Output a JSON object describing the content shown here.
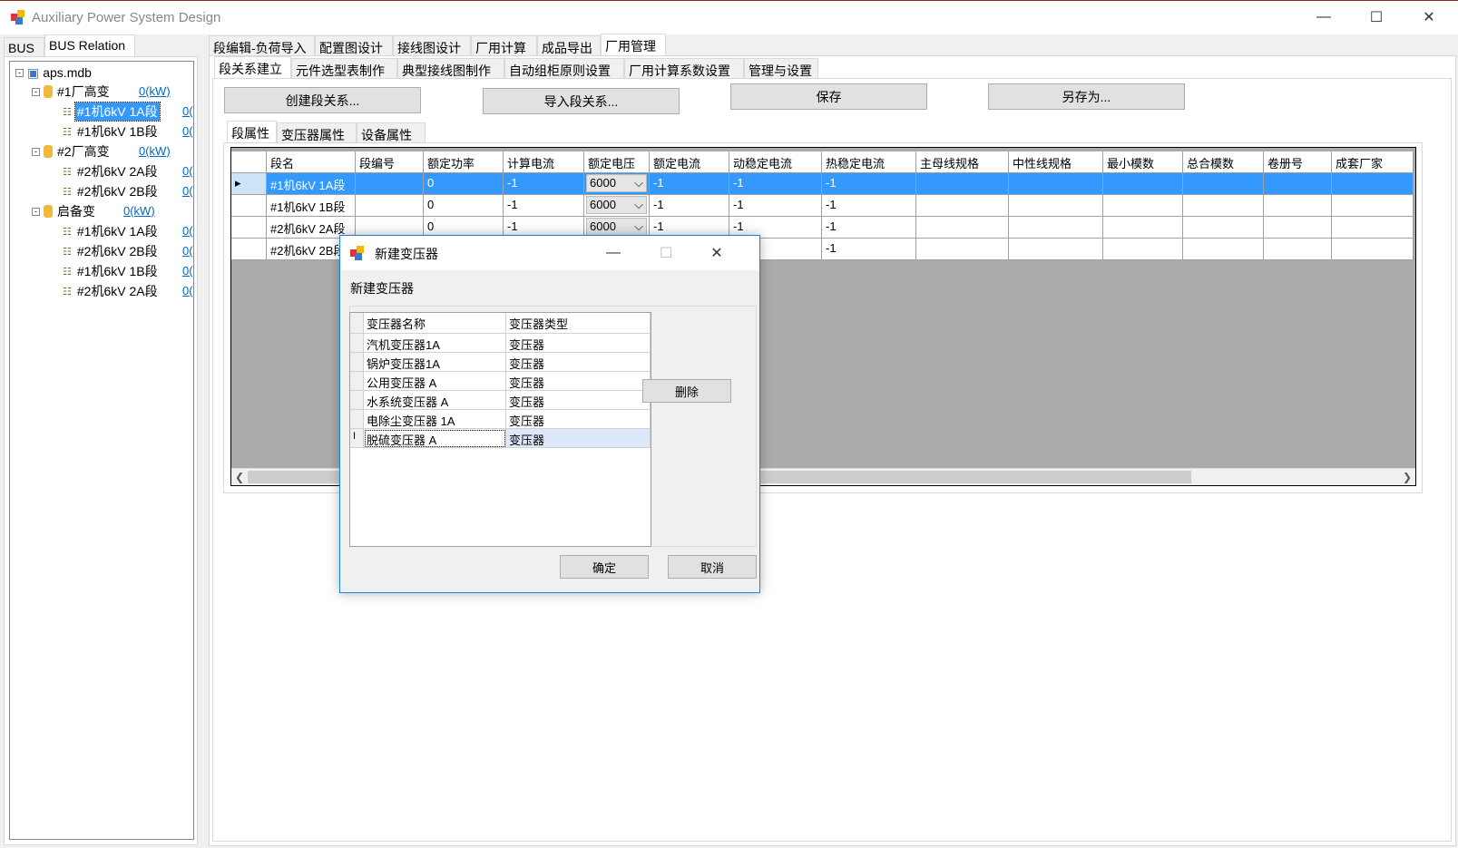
{
  "window": {
    "title": "Auxiliary Power System Design",
    "minimize": "—",
    "maximize": "☐",
    "close": "✕"
  },
  "left_tabs": [
    "BUS",
    "BUS Relation"
  ],
  "tree": {
    "root": "aps.mdb",
    "groups": [
      {
        "label": "#1厂高变",
        "power": "0(kW)",
        "children": [
          {
            "label": "#1机6kV 1A段",
            "power": "0(",
            "selected": true
          },
          {
            "label": "#1机6kV 1B段",
            "power": "0("
          }
        ]
      },
      {
        "label": "#2厂高变",
        "power": "0(kW)",
        "children": [
          {
            "label": "#2机6kV 2A段",
            "power": "0("
          },
          {
            "label": "#2机6kV 2B段",
            "power": "0("
          }
        ]
      },
      {
        "label": "启备变",
        "power": "0(kW)",
        "children": [
          {
            "label": "#1机6kV 1A段",
            "power": "0("
          },
          {
            "label": "#2机6kV 2B段",
            "power": "0("
          },
          {
            "label": "#1机6kV 1B段",
            "power": "0("
          },
          {
            "label": "#2机6kV 2A段",
            "power": "0("
          }
        ]
      }
    ]
  },
  "main_tabs": [
    "段编辑-负荷导入",
    "配置图设计",
    "接线图设计",
    "厂用计算",
    "成品导出",
    "厂用管理"
  ],
  "sub_tabs": [
    "段关系建立",
    "元件选型表制作",
    "典型接线图制作",
    "自动组柜原则设置",
    "厂用计算系数设置",
    "管理与设置"
  ],
  "toolbar": {
    "create": "创建段关系...",
    "import": "导入段关系...",
    "save": "保存",
    "save_as": "另存为..."
  },
  "prop_tabs": [
    "段属性",
    "变压器属性",
    "设备属性"
  ],
  "grid": {
    "columns": [
      "段名",
      "段编号",
      "额定功率",
      "计算电流",
      "额定电压",
      "额定电流",
      "动稳定电流",
      "热稳定电流",
      "主母线规格",
      "中性线规格",
      "最小模数",
      "总合模数",
      "卷册号",
      "成套厂家"
    ],
    "rows": [
      [
        "#1机6kV 1A段",
        "",
        "0",
        "-1",
        "6000",
        "-1",
        "-1",
        "-1",
        "",
        "",
        "",
        "",
        "",
        ""
      ],
      [
        "#1机6kV 1B段",
        "",
        "0",
        "-1",
        "6000",
        "-1",
        "-1",
        "-1",
        "",
        "",
        "",
        "",
        "",
        ""
      ],
      [
        "#2机6kV 2A段",
        "",
        "0",
        "-1",
        "6000",
        "-1",
        "-1",
        "-1",
        "",
        "",
        "",
        "",
        "",
        ""
      ],
      [
        "#2机6kV 2B段",
        "",
        "",
        "",
        "",
        "",
        "",
        "-1",
        "",
        "",
        "",
        "",
        "",
        ""
      ]
    ]
  },
  "dialog": {
    "title": "新建变压器",
    "heading": "新建变压器",
    "columns": [
      "变压器名称",
      "变压器类型"
    ],
    "rows": [
      [
        "汽机变压器1A",
        "变压器"
      ],
      [
        "锅炉变压器1A",
        "变压器"
      ],
      [
        "公用变压器 A",
        "变压器"
      ],
      [
        "水系统变压器 A",
        "变压器"
      ],
      [
        "电除尘变压器 1A",
        "变压器"
      ],
      [
        "脱硫变压器 A",
        "变压器"
      ]
    ],
    "delete": "删除",
    "ok": "确定",
    "cancel": "取消"
  }
}
